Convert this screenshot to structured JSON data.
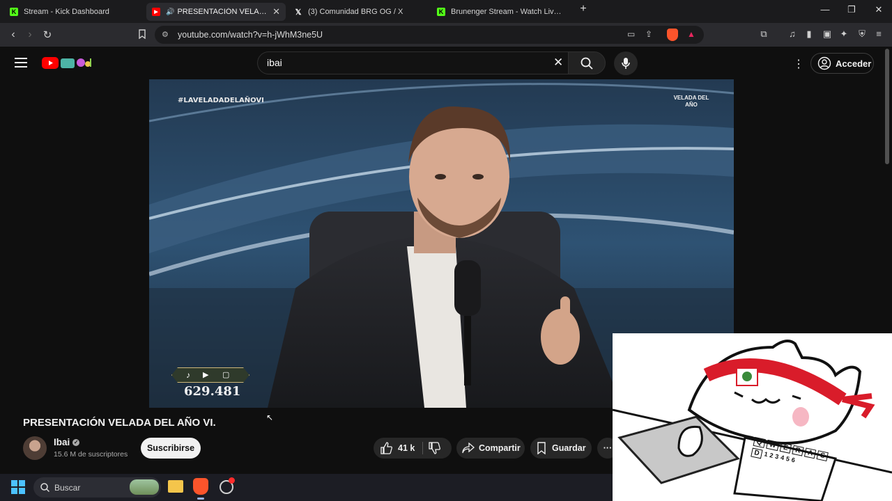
{
  "browser": {
    "tabs": [
      {
        "title": "Stream - Kick Dashboard",
        "icon": "kick-icon"
      },
      {
        "title": "PRESENTACIÓN VELADA DEL",
        "icon": "youtube-icon",
        "active": true
      },
      {
        "title": "(3) Comunidad BRG OG / X",
        "icon": "x-icon"
      },
      {
        "title": "Brunenger Stream - Watch Live on Ki",
        "icon": "kick-icon"
      }
    ],
    "new_tab_symbol": "+",
    "url": "youtube.com/watch?v=h-jWhM3ne5U"
  },
  "youtube": {
    "search_value": "ibai",
    "sign_in_label": "Acceder"
  },
  "video": {
    "hashtag": "#LAVELADADELAÑOVI",
    "logo_text": "VELADA DEL AÑO",
    "banner_text": "VELADA DEL AÑO",
    "viewer_count": "629.481"
  },
  "details": {
    "title": "PRESENTACIÓN VELADA DEL AÑO VI.",
    "channel_name": "Ibai",
    "subscribers": "15.6 M de suscriptores",
    "subscribe_label": "Suscribirse",
    "likes": "41 k",
    "share_label": "Compartir",
    "save_label": "Guardar"
  },
  "taskbar": {
    "search_placeholder": "Buscar"
  },
  "overlay": {
    "keyboard_keys": [
      "Q",
      "W",
      "E",
      "R",
      "A",
      "S",
      "D",
      "1",
      "2",
      "3",
      "4",
      "5",
      "6"
    ]
  },
  "colors": {
    "accent_red": "#ff0000",
    "kick_green": "#53fc18",
    "background": "#0f0f0f"
  }
}
